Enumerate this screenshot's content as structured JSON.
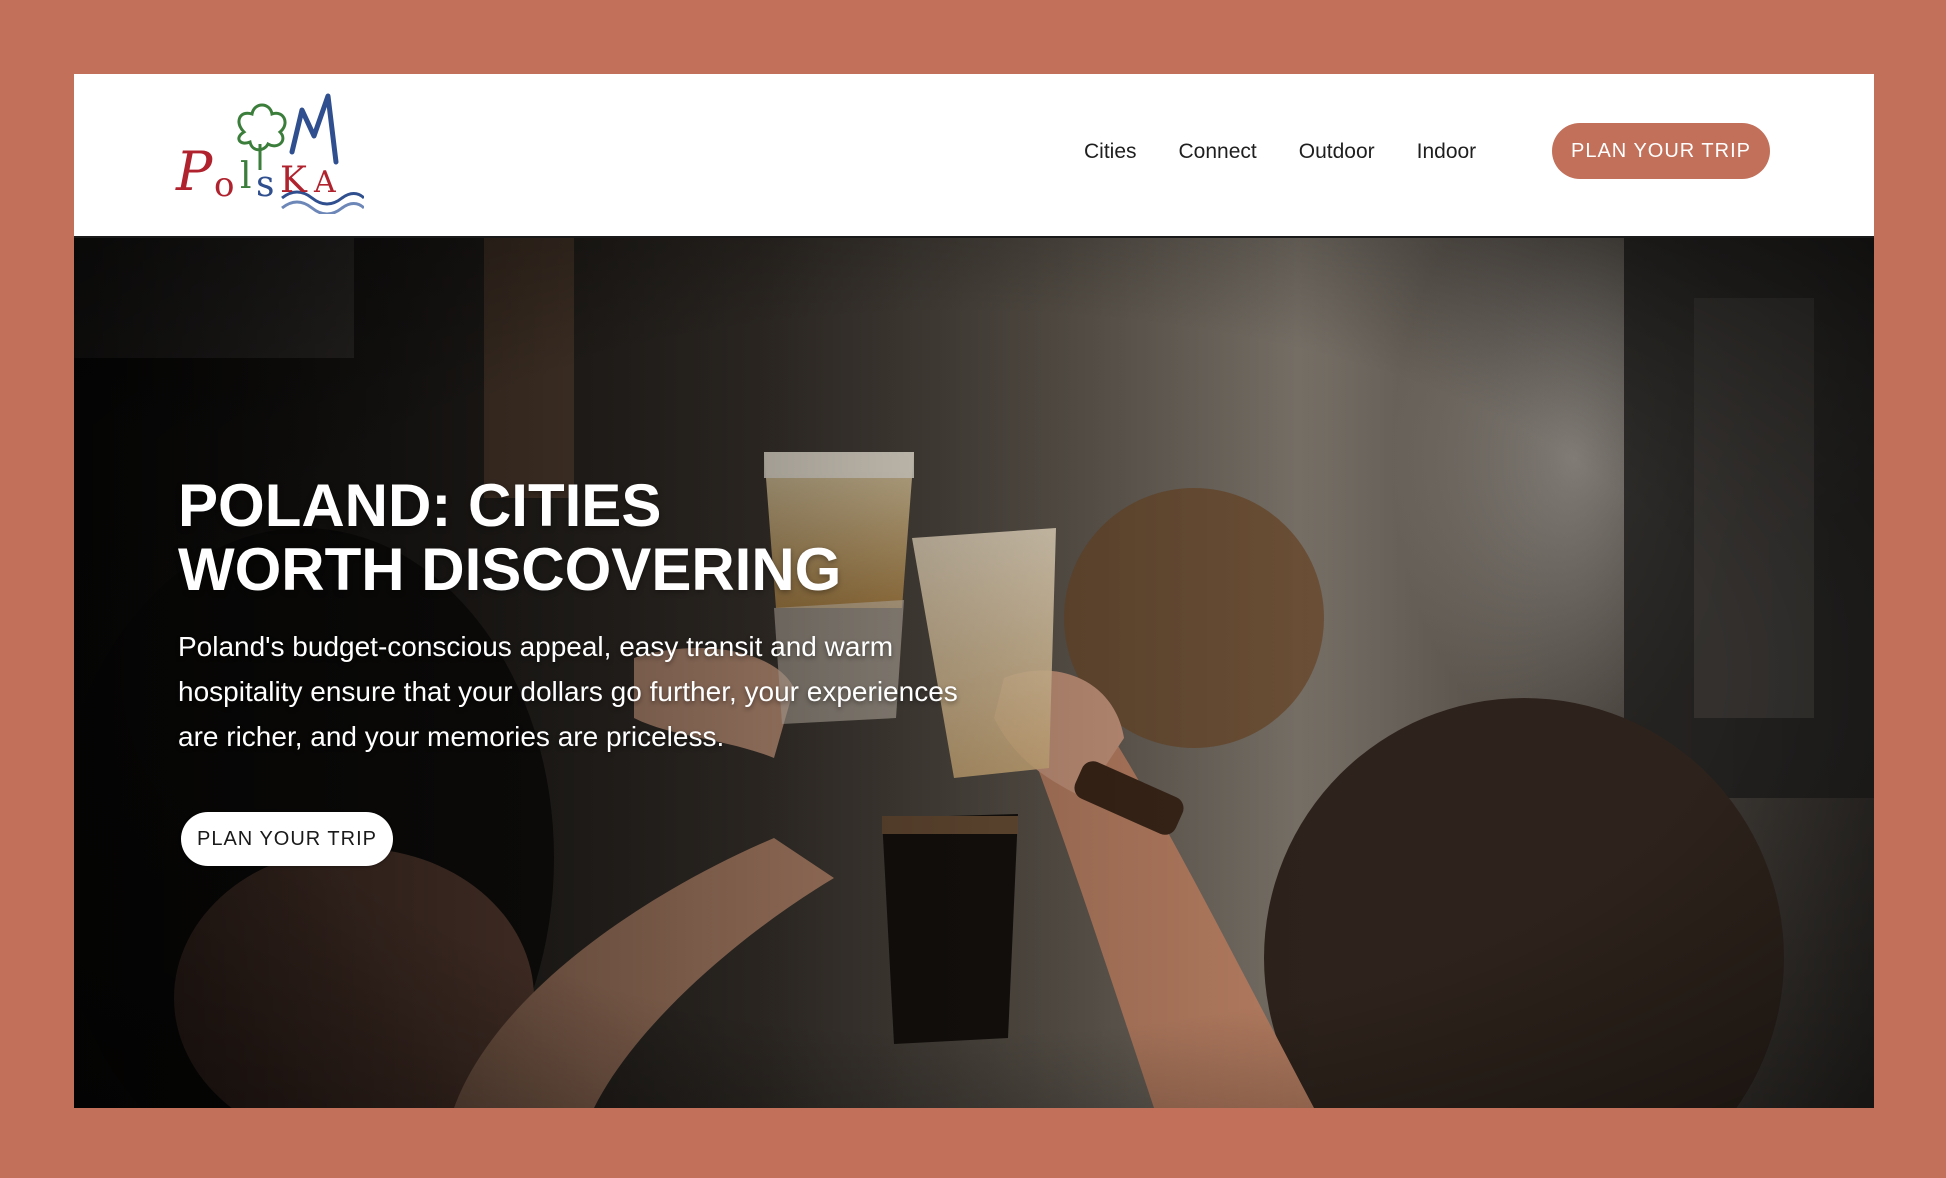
{
  "brand": {
    "logo_text": "Polska",
    "colors": {
      "accent": "#c2705a",
      "logo_red": "#b0232e",
      "logo_green": "#3b7d3a",
      "logo_blue": "#2f4f8f"
    }
  },
  "nav": {
    "items": [
      {
        "label": "Cities"
      },
      {
        "label": "Connect"
      },
      {
        "label": "Outdoor"
      },
      {
        "label": "Indoor"
      }
    ],
    "cta_label": "PLAN YOUR TRIP"
  },
  "hero": {
    "title_line1": "POLAND: CITIES",
    "title_line2": "WORTH DISCOVERING",
    "body": "Poland's budget-conscious appeal, easy transit and warm hospitality ensure that your dollars go further, your experiences are richer, and your memories are priceless.",
    "cta_label": "PLAN YOUR TRIP",
    "image_subject": "friends toasting with beer glasses in a bar"
  }
}
